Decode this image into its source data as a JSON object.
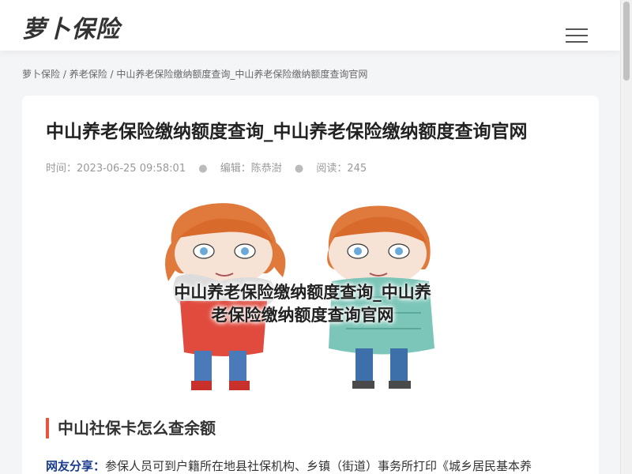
{
  "header": {
    "logo": "萝卜保险"
  },
  "breadcrumb": {
    "items": [
      "萝卜保险",
      "养老保险",
      "中山养老保险缴纳额度查询_中山养老保险缴纳额度查询官网"
    ],
    "separator": " / "
  },
  "article": {
    "title": "中山养老保险缴纳额度查询_中山养老保险缴纳额度查询官网",
    "meta": {
      "time_label": "时间：",
      "time_value": "2023-06-25 09:58:01",
      "editor_label": "编辑：",
      "editor_value": "陈恭澍",
      "views_label": "阅读：",
      "views_value": "245"
    },
    "image_overlay_line1": "中山养老保险缴纳额度查询_中山养",
    "image_overlay_line2": "老保险缴纳额度查询官网",
    "section_heading": "中山社保卡怎么查余额",
    "share_label": "网友分享：",
    "share_text": "参保人员可到户籍所在地县社保机构、乡镇（街道）事务所打印《城乡居民基本养"
  },
  "colors": {
    "accent": "#e8553e",
    "share_label": "#1a3c8f"
  }
}
